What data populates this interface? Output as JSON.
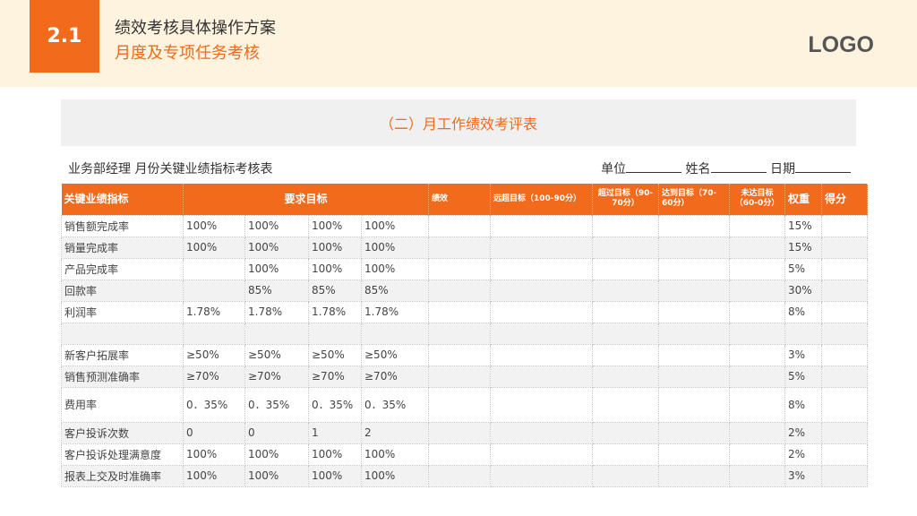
{
  "header": {
    "section_number": "2.1",
    "title": "绩效考核具体操作方案",
    "subtitle": "月度及专项任务考核",
    "logo": "LOGO"
  },
  "colors": {
    "accent": "#f26a1b",
    "header_bg": "#fdf3de",
    "row_alt": "#f2f2f2"
  },
  "table_title": "（二）月工作绩效考评表",
  "info": {
    "left": "业务部经理 月份关键业绩指标考核表",
    "unit_label": "单位",
    "name_label": "姓名",
    "date_label": "日期"
  },
  "columns": {
    "kpi": "关键业绩指标",
    "target": "要求目标",
    "performance": "绩效",
    "exceed": "远超目标（100-90分）",
    "over": "超过目标（90-70分）",
    "reach": "达到目标（70-60分）",
    "miss": "未达目标（60-0分）",
    "weight": "权重",
    "score": "得分"
  },
  "rows": [
    {
      "name": "销售额完成率",
      "t1": "100%",
      "t2": "100%",
      "t3": "100%",
      "t4": "100%",
      "weight": "15%"
    },
    {
      "name": "销量完成率",
      "t1": "100%",
      "t2": "100%",
      "t3": "100%",
      "t4": "100%",
      "weight": "15%"
    },
    {
      "name": "产品完成率",
      "t1": "",
      "t2": "100%",
      "t3": "100%",
      "t4": "100%",
      "weight": "5%"
    },
    {
      "name": "回款率",
      "t1": "",
      "t2": "85%",
      "t3": "85%",
      "t4": "85%",
      "weight": "30%"
    },
    {
      "name": "利润率",
      "t1": "1.78%",
      "t2": "1.78%",
      "t3": "1.78%",
      "t4": "1.78%",
      "weight": "8%"
    },
    {
      "name": "",
      "t1": "",
      "t2": "",
      "t3": "",
      "t4": "",
      "weight": ""
    },
    {
      "name": "新客户拓展率",
      "t1": "≥50%",
      "t2": "≥50%",
      "t3": "≥50%",
      "t4": "≥50%",
      "weight": "3%"
    },
    {
      "name": "销售预测准确率",
      "t1": "≥70%",
      "t2": "≥70%",
      "t3": "≥70%",
      "t4": "≥70%",
      "weight": "5%"
    },
    {
      "name": "费用率",
      "t1": "0．35%",
      "t2": "0．35%",
      "t3": "0．35%",
      "t4": "0．35%",
      "weight": "8%"
    },
    {
      "name": "客户投诉次数",
      "t1": "0",
      "t2": "0",
      "t3": "1",
      "t4": "2",
      "weight": "2%"
    },
    {
      "name": "客户投诉处理满意度",
      "t1": "100%",
      "t2": "100%",
      "t3": "100%",
      "t4": "100%",
      "weight": "2%"
    },
    {
      "name": "报表上交及时准确率",
      "t1": "100%",
      "t2": "100%",
      "t3": "100%",
      "t4": "100%",
      "weight": "3%"
    }
  ]
}
